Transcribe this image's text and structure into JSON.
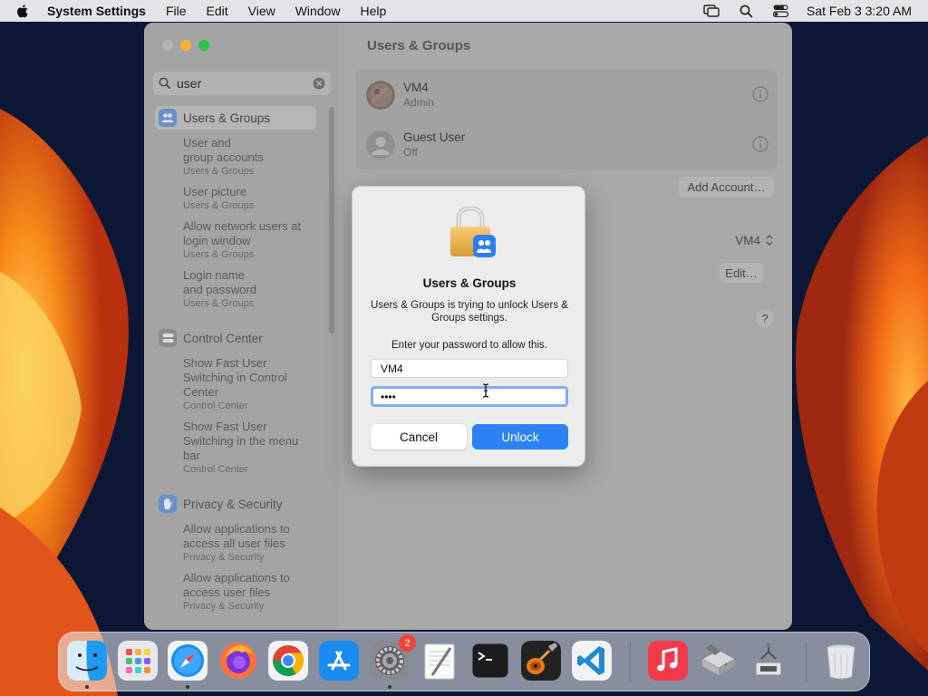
{
  "menubar": {
    "app_name": "System Settings",
    "menus": [
      "File",
      "Edit",
      "View",
      "Window",
      "Help"
    ],
    "clock": "Sat Feb 3  3:20 AM"
  },
  "window": {
    "title": "Users & Groups",
    "search": {
      "value": "user"
    }
  },
  "sidebar": {
    "categories": [
      {
        "label": "Users & Groups",
        "icon": "users-groups-icon",
        "color": "#6b8fc7"
      },
      {
        "label": "Control Center",
        "icon": "control-center-icon",
        "color": "#8c8c8c"
      },
      {
        "label": "Privacy & Security",
        "icon": "hand-icon",
        "color": "#6b8fc7"
      }
    ],
    "results": [
      {
        "title_lines": [
          "User and",
          "group accounts"
        ],
        "sub": "Users & Groups"
      },
      {
        "title_lines": [
          "User picture"
        ],
        "sub": "Users & Groups"
      },
      {
        "title_lines": [
          "Allow network users at",
          "login window"
        ],
        "sub": "Users & Groups"
      },
      {
        "title_lines": [
          "Login name",
          "and password"
        ],
        "sub": "Users & Groups"
      },
      {
        "title_lines": [
          "Show Fast User",
          "Switching in Control",
          "Center"
        ],
        "sub": "Control Center"
      },
      {
        "title_lines": [
          "Show Fast User",
          "Switching in the menu",
          "bar"
        ],
        "sub": "Control Center"
      },
      {
        "title_lines": [
          "Allow applications to",
          "access all user files"
        ],
        "sub": "Privacy & Security"
      },
      {
        "title_lines": [
          "Allow applications to",
          "access user files"
        ],
        "sub": "Privacy & Security"
      }
    ]
  },
  "main": {
    "users": [
      {
        "name": "VM4",
        "role": "Admin"
      },
      {
        "name": "Guest User",
        "role": "Off"
      }
    ],
    "add_account_label": "Add Account…",
    "auto_login_value": "VM4",
    "edit_label": "Edit…",
    "help_label": "?"
  },
  "dialog": {
    "title": "Users & Groups",
    "message": "Users & Groups is trying to unlock Users & Groups settings.",
    "prompt": "Enter your password to allow this.",
    "username_value": "VM4",
    "password_value": "••••",
    "cancel_label": "Cancel",
    "unlock_label": "Unlock"
  },
  "dock": {
    "settings_badge": "2",
    "apps": [
      "Finder",
      "Launchpad",
      "Safari",
      "Firefox",
      "Chrome",
      "App Store",
      "System Settings",
      "TextEdit",
      "Terminal",
      "GarageBand",
      "Visual Studio Code",
      "Music",
      "Utility",
      "Utility",
      "Trash"
    ]
  }
}
